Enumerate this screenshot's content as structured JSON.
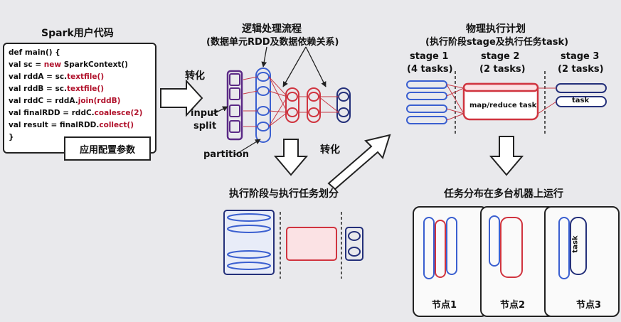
{
  "code_title": "Spark用户代码",
  "code_lines": [
    "def main() {",
    "  val sc = new SparkContext()",
    "  val rddA = sc.textfile()",
    "  val rddB = sc.textfile()",
    "  val rddC = rddA.join(rddB)",
    "  val finalRDD = rddC.coalesce(2)",
    "  val result = finalRDD.collect()",
    "}"
  ],
  "config_label": "应用配置参数",
  "transform_label": "转化",
  "input_split_label_1": "input",
  "input_split_label_2": "split",
  "partition_label": "partition",
  "logical_title": "逻辑处理流程",
  "logical_subtitle": "(数据单元RDD及数据依赖关系)",
  "transform_label_2": "转化",
  "stage_split_title": "执行阶段与执行任务划分",
  "physical_title": "物理执行计划",
  "physical_subtitle": "(执行阶段stage及执行任务task)",
  "stages": [
    {
      "name": "stage 1",
      "tasks": "(4 tasks)"
    },
    {
      "name": "stage 2",
      "tasks": "(2 tasks)"
    },
    {
      "name": "stage 3",
      "tasks": "(2 tasks)"
    }
  ],
  "map_reduce_label": "map/reduce task",
  "task_label": "task",
  "distribution_title": "任务分布在多台机器上运行",
  "nodes": [
    "节点1",
    "节点2",
    "节点3"
  ],
  "task_label_rotated": "task",
  "colors": {
    "purple": "#5b2a86",
    "blue": "#3a5fd0",
    "red": "#d0343f",
    "navy": "#24307a"
  }
}
